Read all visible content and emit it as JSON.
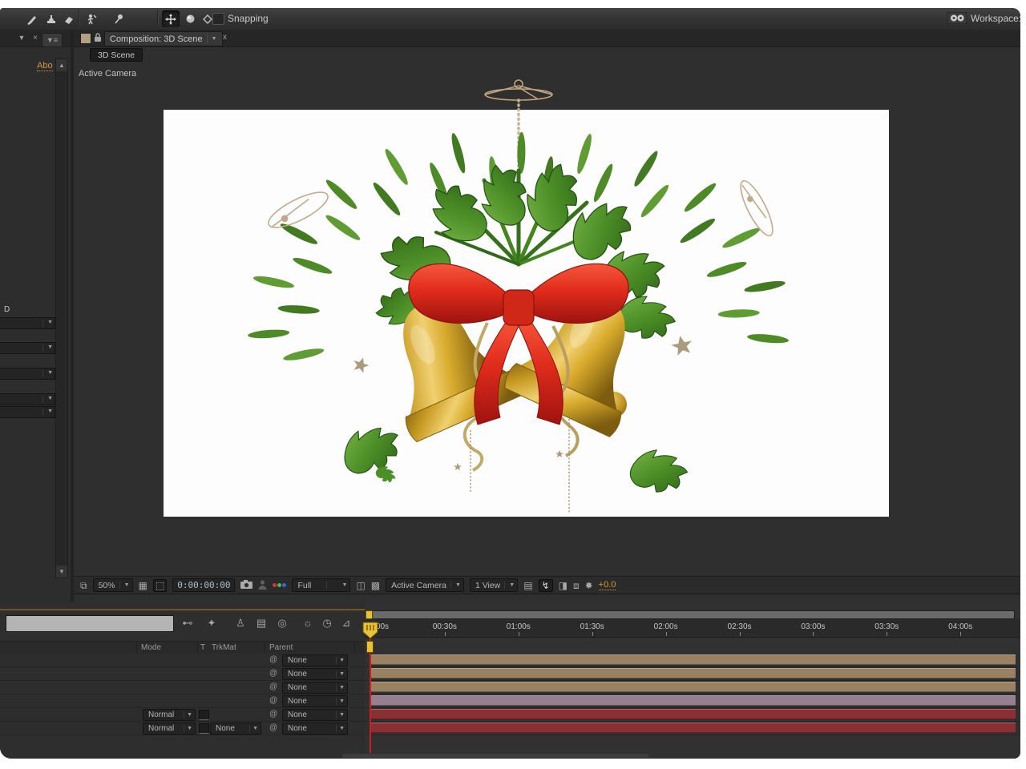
{
  "toolbar": {
    "snapping_label": "Snapping",
    "workspace_label": "Workspace:"
  },
  "left_panel": {
    "about_link": "Abo",
    "partial_label": "D"
  },
  "comp_panel": {
    "header_title": "Composition: 3D Scene",
    "close_label": "x",
    "comp_tab_label": "3D Scene",
    "view_label": "Active Camera",
    "footer": {
      "zoom_value": "50%",
      "timecode": "0:00:00:00",
      "resolution_value": "Full",
      "camera_value": "Active Camera",
      "view_layout_value": "1 View",
      "exposure_value": "+0.0"
    }
  },
  "timeline": {
    "columns": {
      "mode": "Mode",
      "t": "T",
      "trkmat": "TrkMat",
      "parent": "Parent"
    },
    "ruler_ticks": [
      "00s",
      "00:30s",
      "01:00s",
      "01:30s",
      "02:00s",
      "02:30s",
      "03:00s",
      "03:30s",
      "04:00s"
    ],
    "rows": [
      {
        "mode": null,
        "t": false,
        "trkmat": null,
        "parent": "None",
        "color": "#9a8164"
      },
      {
        "mode": null,
        "t": false,
        "trkmat": null,
        "parent": "None",
        "color": "#9a8164"
      },
      {
        "mode": null,
        "t": false,
        "trkmat": null,
        "parent": "None",
        "color": "#9a8164"
      },
      {
        "mode": null,
        "t": false,
        "trkmat": null,
        "parent": "None",
        "color": "#968090"
      },
      {
        "mode": "Normal",
        "t": true,
        "trkmat": null,
        "parent": "None",
        "color": "#8a3035"
      },
      {
        "mode": "Normal",
        "t": true,
        "trkmat": "None",
        "parent": "None",
        "color": "#8a3035"
      }
    ]
  },
  "colors": {
    "accent_orange": "#c8972c",
    "playhead_yellow": "#e8c235",
    "cti_red": "#cc1f1f",
    "layer_tan": "#9a8164",
    "layer_mauve": "#968090",
    "layer_red": "#8a3035"
  }
}
